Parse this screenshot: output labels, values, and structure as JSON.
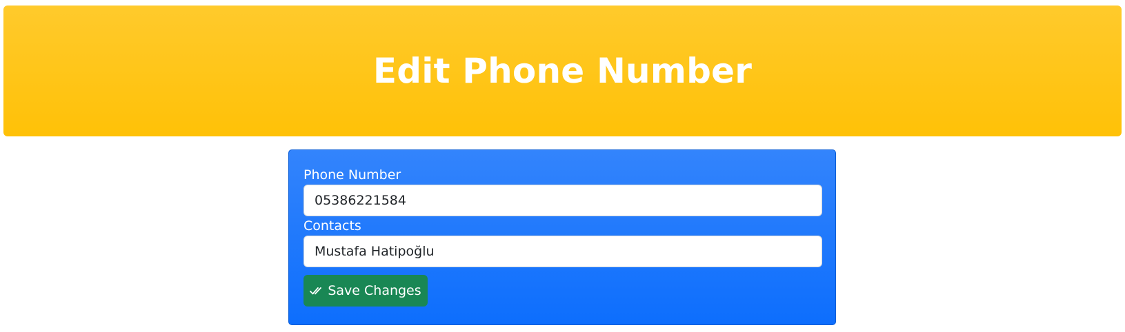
{
  "header": {
    "title": "Edit Phone Number"
  },
  "form": {
    "phone_label": "Phone Number",
    "phone_value": "05386221584",
    "contacts_label": "Contacts",
    "contacts_value": "Mustafa Hatipoğlu",
    "save_label": "Save Changes",
    "save_icon": "check-all-icon"
  },
  "colors": {
    "header_bg": "#ffc107",
    "card_bg": "#0d6efd",
    "save_button_bg": "#198754",
    "text_on_color": "#ffffff"
  }
}
